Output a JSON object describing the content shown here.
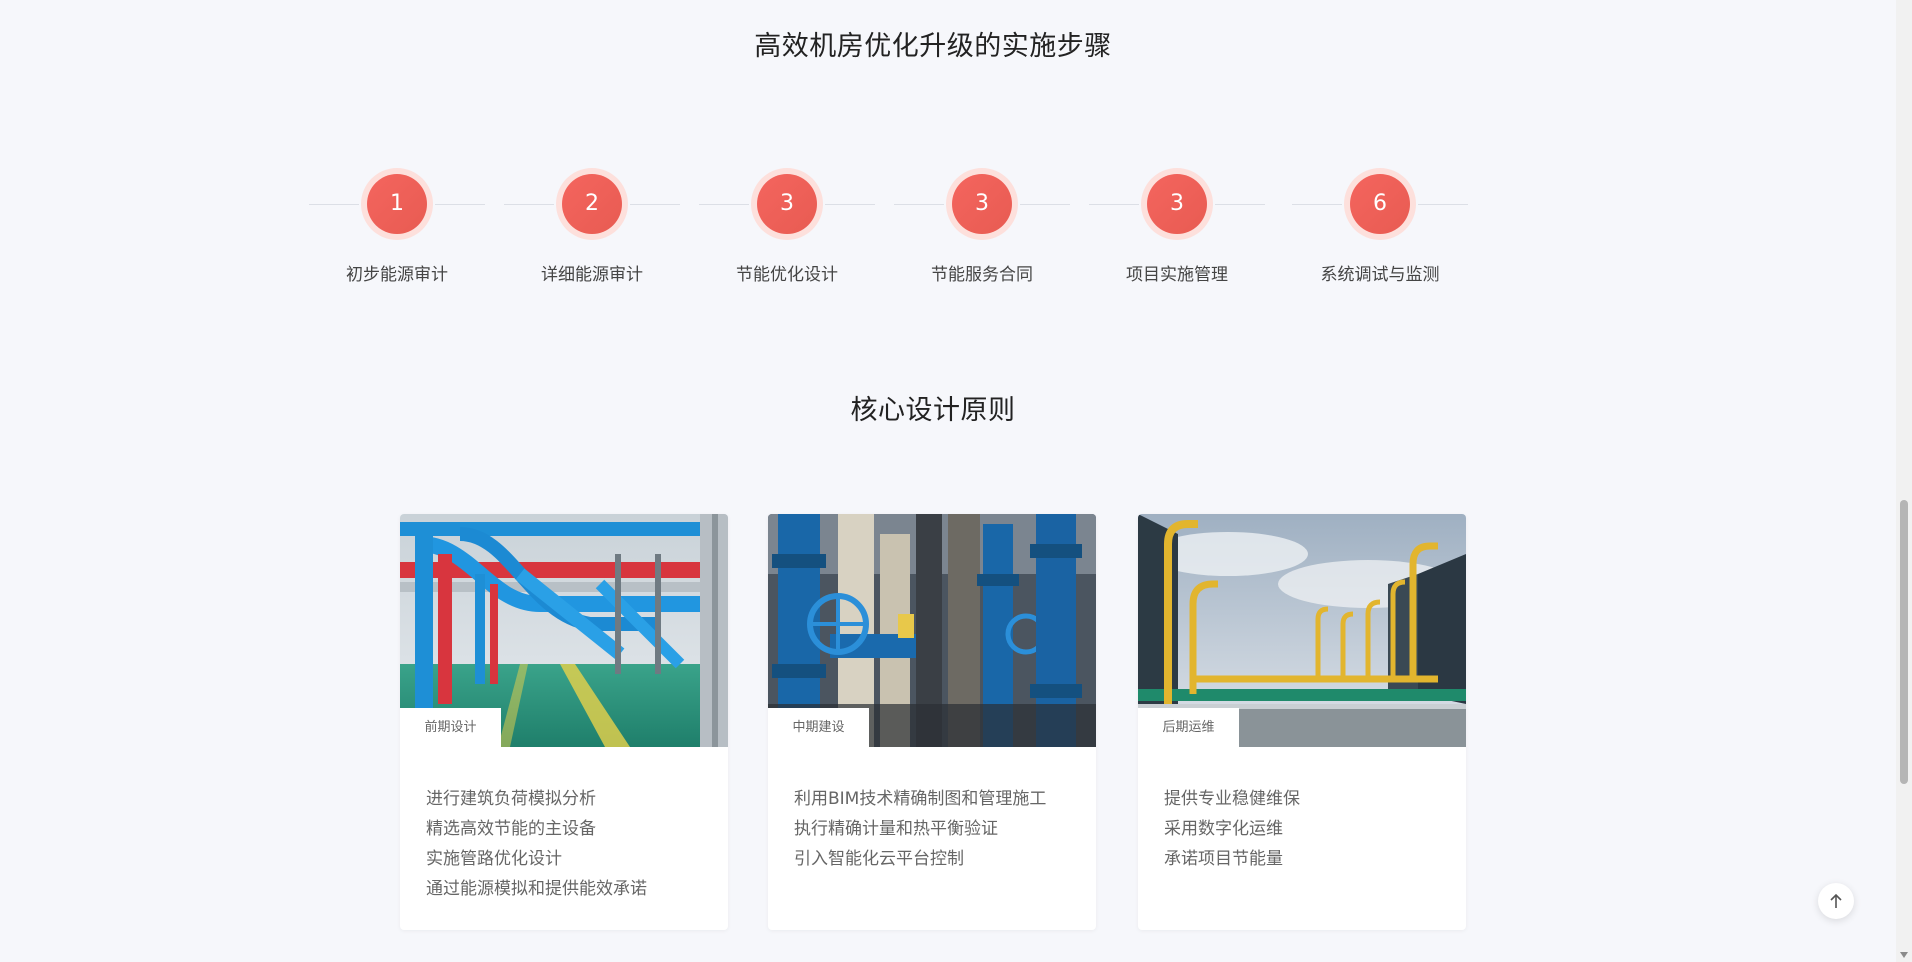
{
  "sections": {
    "steps_title": "高效机房优化升级的实施步骤",
    "principles_title": "核心设计原则"
  },
  "steps": [
    {
      "number": "1",
      "label": "初步能源审计"
    },
    {
      "number": "2",
      "label": "详细能源审计"
    },
    {
      "number": "3",
      "label": "节能优化设计"
    },
    {
      "number": "3",
      "label": "节能服务合同"
    },
    {
      "number": "3",
      "label": "项目实施管理"
    },
    {
      "number": "6",
      "label": "系统调试与监测"
    }
  ],
  "cards": [
    {
      "tag": "前期设计",
      "image_icon": "pipes-factory-floor-image",
      "items": [
        "进行建筑负荷模拟分析",
        "精选高效节能的主设备",
        "实施管路优化设计",
        "通过能源模拟和提供能效承诺"
      ]
    },
    {
      "tag": "中期建设",
      "image_icon": "valves-pipes-image",
      "items": [
        "利用BIM技术精确制图和管理施工",
        "执行精确计量和热平衡验证",
        "引入智能化云平台控制"
      ]
    },
    {
      "tag": "后期运维",
      "image_icon": "rooftop-cooling-tower-image",
      "items": [
        "提供专业稳健维保",
        "采用数字化运维",
        "承诺项目节能量"
      ]
    }
  ],
  "colors": {
    "accent": "#f4655e",
    "accent_ring": "#fde0dc",
    "background": "#f6f7fb"
  },
  "icons": {
    "back_to_top": "arrow-up-icon"
  }
}
